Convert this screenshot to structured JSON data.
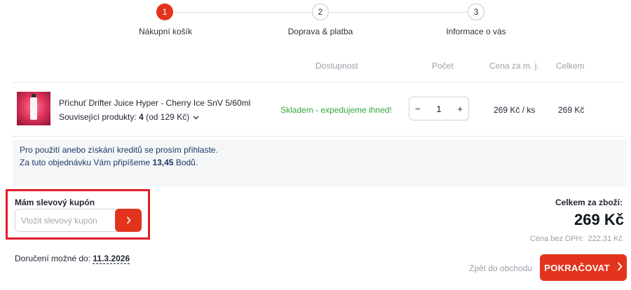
{
  "steps": [
    {
      "number": "1",
      "label": "Nákupní košík"
    },
    {
      "number": "2",
      "label": "Doprava & platba"
    },
    {
      "number": "3",
      "label": "Informace o vás"
    }
  ],
  "table": {
    "headers": {
      "availability": "Dostupnost",
      "quantity": "Počet",
      "unit_price": "Cena za m. j.",
      "total": "Celkem"
    }
  },
  "product": {
    "name": "Příchuť Drifter Juice Hyper - Cherry Ice SnV 5/60ml",
    "related_label": "Související produkty:",
    "related_count": "4",
    "related_from": "(od 129 Kč)",
    "stock": "Skladem - expedujeme ihned!",
    "quantity": "1",
    "minus": "−",
    "plus": "+",
    "unit_price": "269 Kč / ks",
    "total_price": "269 Kč"
  },
  "credits": {
    "line1": "Pro použití anebo získání kreditů se prosím přihlaste.",
    "line2_prefix": "Za tuto objednávku Vám připíšeme",
    "line2_points": "13,45",
    "line2_suffix": "Bodů."
  },
  "coupon": {
    "title": "Mám slevový kupón",
    "placeholder": "Vložit slevový kupón",
    "button_icon": "chevron-right-icon"
  },
  "delivery": {
    "label": "Doručení možné do:",
    "date": "11.3.2026"
  },
  "summary": {
    "label": "Celkem za zboží:",
    "value": "269 Kč",
    "net_label": "Cena bez DPH:",
    "net_value": "222,31 Kč"
  },
  "actions": {
    "back": "Zpět do obchodu",
    "continue": "POKRAČOVAT"
  },
  "colors": {
    "accent": "#e2341d",
    "stock": "#2eaa3a",
    "highlight": "#e01f2a"
  }
}
